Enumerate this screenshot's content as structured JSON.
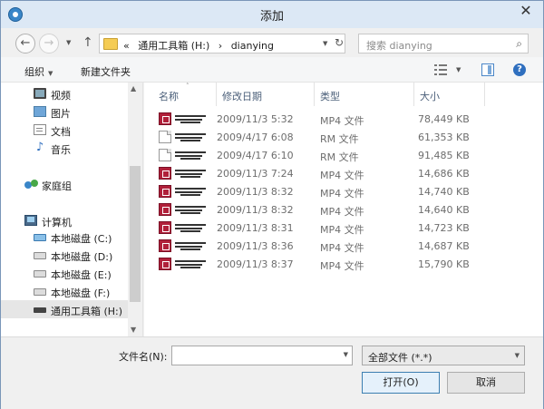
{
  "window": {
    "title": "添加"
  },
  "navbar": {
    "breadcrumb_prefix": "«",
    "breadcrumb_drive": "通用工具箱 (H:)",
    "breadcrumb_sep": "›",
    "breadcrumb_folder": "dianying",
    "search_placeholder": "搜索 dianying"
  },
  "toolbar": {
    "organize": "组织",
    "new_folder": "新建文件夹"
  },
  "nav_pane": {
    "libraries": [
      {
        "label": "视频",
        "icon": "video-icon"
      },
      {
        "label": "图片",
        "icon": "picture-icon"
      },
      {
        "label": "文档",
        "icon": "document-icon"
      },
      {
        "label": "音乐",
        "icon": "music-icon"
      }
    ],
    "homegroup": "家庭组",
    "computer": "计算机",
    "drives": [
      {
        "label": "本地磁盘 (C:)",
        "icon": "system-drive-icon"
      },
      {
        "label": "本地磁盘 (D:)",
        "icon": "drive-icon"
      },
      {
        "label": "本地磁盘 (E:)",
        "icon": "drive-icon"
      },
      {
        "label": "本地磁盘 (F:)",
        "icon": "drive-icon"
      },
      {
        "label": "通用工具箱 (H:)",
        "icon": "usb-drive-icon",
        "selected": true
      }
    ]
  },
  "columns": {
    "name": "名称",
    "modified": "修改日期",
    "type": "类型",
    "size": "大小"
  },
  "files": [
    {
      "icon": "mp4",
      "modified": "2009/11/3 5:32",
      "type": "MP4 文件",
      "size": "78,449 KB"
    },
    {
      "icon": "rm",
      "modified": "2009/4/17 6:08",
      "type": "RM 文件",
      "size": "61,353 KB"
    },
    {
      "icon": "rm",
      "modified": "2009/4/17 6:10",
      "type": "RM 文件",
      "size": "91,485 KB"
    },
    {
      "icon": "mp4",
      "modified": "2009/11/3 7:24",
      "type": "MP4 文件",
      "size": "14,686 KB"
    },
    {
      "icon": "mp4",
      "modified": "2009/11/3 8:32",
      "type": "MP4 文件",
      "size": "14,740 KB"
    },
    {
      "icon": "mp4",
      "modified": "2009/11/3 8:32",
      "type": "MP4 文件",
      "size": "14,640 KB"
    },
    {
      "icon": "mp4",
      "modified": "2009/11/3 8:31",
      "type": "MP4 文件",
      "size": "14,723 KB"
    },
    {
      "icon": "mp4",
      "modified": "2009/11/3 8:36",
      "type": "MP4 文件",
      "size": "14,687 KB"
    },
    {
      "icon": "mp4",
      "modified": "2009/11/3 8:37",
      "type": "MP4 文件",
      "size": "15,790 KB"
    }
  ],
  "bottom": {
    "filename_label": "文件名(N):",
    "filename_value": "",
    "filetype_value": "全部文件 (*.*)",
    "open_label": "打开(O)",
    "cancel_label": "取消"
  },
  "colors": {
    "mp4_icon": "#b0203a",
    "folder": "#f5cc54",
    "selection": "#e6e6e6"
  }
}
